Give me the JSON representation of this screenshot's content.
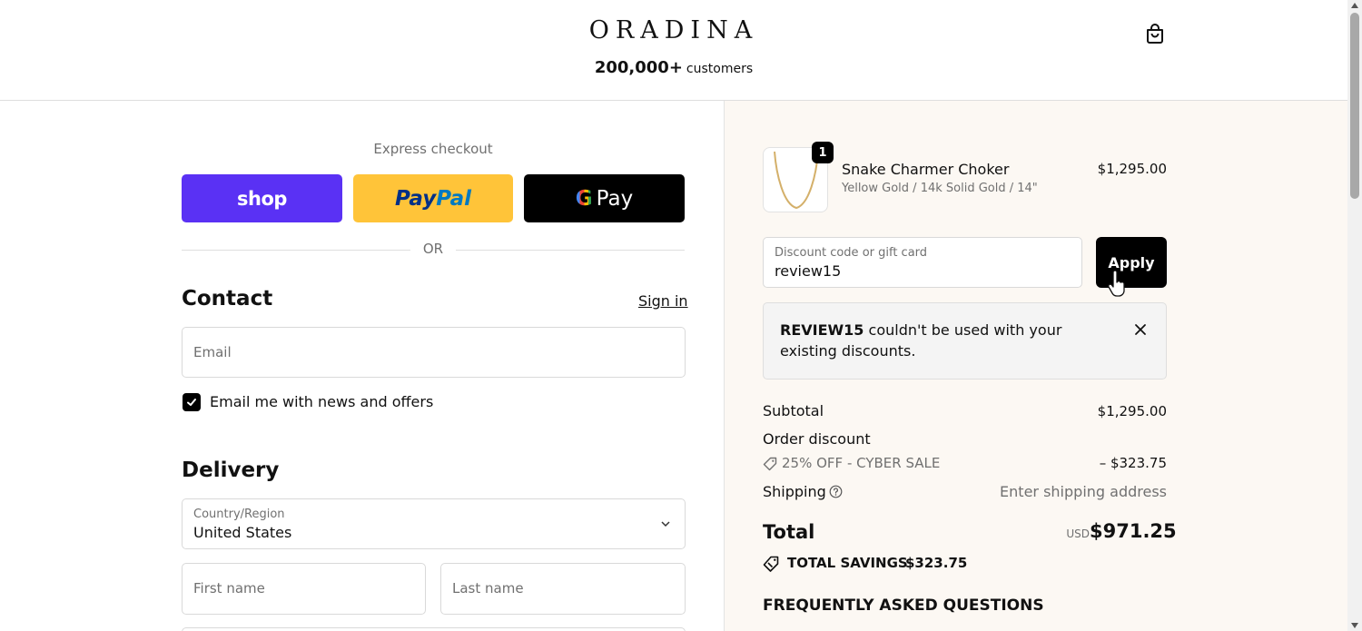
{
  "header": {
    "brand": "ORADINA",
    "customers_count": "200,000+",
    "customers_label": "customers",
    "cart_icon": "shopping-bag-icon"
  },
  "express": {
    "title": "Express checkout",
    "shop_label": "shop",
    "paypal_label_a": "Pay",
    "paypal_label_b": "Pal",
    "gpay_g": "G",
    "gpay_label": "Pay",
    "or_label": "OR"
  },
  "contact": {
    "title": "Contact",
    "signin_label": "Sign in",
    "email_placeholder": "Email",
    "newsletter_label": "Email me with news and offers",
    "newsletter_checked": true
  },
  "delivery": {
    "title": "Delivery",
    "country_label": "Country/Region",
    "country_value": "United States",
    "first_name_placeholder": "First name",
    "last_name_placeholder": "Last name"
  },
  "cart": {
    "item": {
      "quantity": "1",
      "name": "Snake Charmer Choker",
      "variant": "Yellow Gold / 14k Solid Gold / 14\"",
      "price": "$1,295.00"
    },
    "discount_label": "Discount code or gift card",
    "discount_value": "review15",
    "apply_label": "Apply",
    "alert_code": "REVIEW15",
    "alert_message": " couldn't be used with your existing discounts.",
    "subtotal_label": "Subtotal",
    "subtotal_value": "$1,295.00",
    "order_discount_label": "Order discount",
    "discount_name": "25% OFF - CYBER SALE",
    "discount_amount": "– $323.75",
    "shipping_label": "Shipping",
    "shipping_value": "Enter shipping address",
    "total_label": "Total",
    "total_currency": "USD",
    "total_value": "$971.25",
    "savings_label": "TOTAL SAVINGS",
    "savings_value": "$323.75",
    "faq_title": "FREQUENTLY ASKED QUESTIONS"
  },
  "colors": {
    "shop_pay": "#5a31f4",
    "paypal": "#ffc439",
    "summary_bg": "#fcf8f3"
  }
}
